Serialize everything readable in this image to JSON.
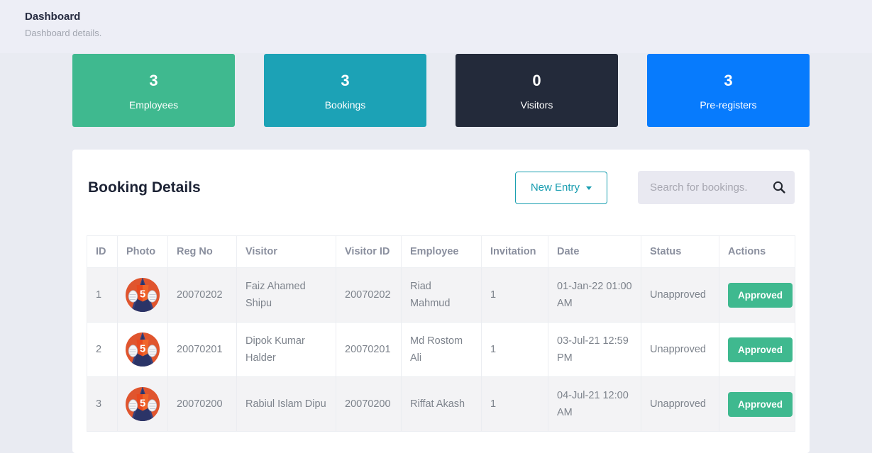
{
  "header": {
    "title": "Dashboard",
    "subtitle": "Dashboard details."
  },
  "stats": [
    {
      "value": "3",
      "label": "Employees",
      "color": "#3fb98f"
    },
    {
      "value": "3",
      "label": "Bookings",
      "color": "#1ca2b6"
    },
    {
      "value": "0",
      "label": "Visitors",
      "color": "#232a3a"
    },
    {
      "value": "3",
      "label": "Pre-registers",
      "color": "#077bfd"
    }
  ],
  "booking": {
    "title": "Booking Details",
    "new_entry_label": "New Entry",
    "search_placeholder": "Search for bookings.",
    "table": {
      "headers": [
        "ID",
        "Photo",
        "Reg No",
        "Visitor",
        "Visitor ID",
        "Employee",
        "Invitation",
        "Date",
        "Status",
        "Actions"
      ],
      "rows": [
        {
          "id": "1",
          "reg_no": "20070202",
          "visitor": "Faiz Ahamed Shipu",
          "visitor_id": "20070202",
          "employee": "Riad Mahmud",
          "invitation": "1",
          "date": "01-Jan-22 01:00 AM",
          "status": "Unapproved",
          "action": "Approved"
        },
        {
          "id": "2",
          "reg_no": "20070201",
          "visitor": "Dipok Kumar Halder",
          "visitor_id": "20070201",
          "employee": "Md Rostom Ali",
          "invitation": "1",
          "date": "03-Jul-21 12:59 PM",
          "status": "Unapproved",
          "action": "Approved"
        },
        {
          "id": "3",
          "reg_no": "20070200",
          "visitor": "Rabiul Islam Dipu",
          "visitor_id": "20070200",
          "employee": "Riffat Akash",
          "invitation": "1",
          "date": "04-Jul-21 12:00 AM",
          "status": "Unapproved",
          "action": "Approved"
        }
      ]
    }
  },
  "icons": {
    "search": "magnifier",
    "caret": "chevron-down",
    "avatar": "html5-superhero"
  }
}
